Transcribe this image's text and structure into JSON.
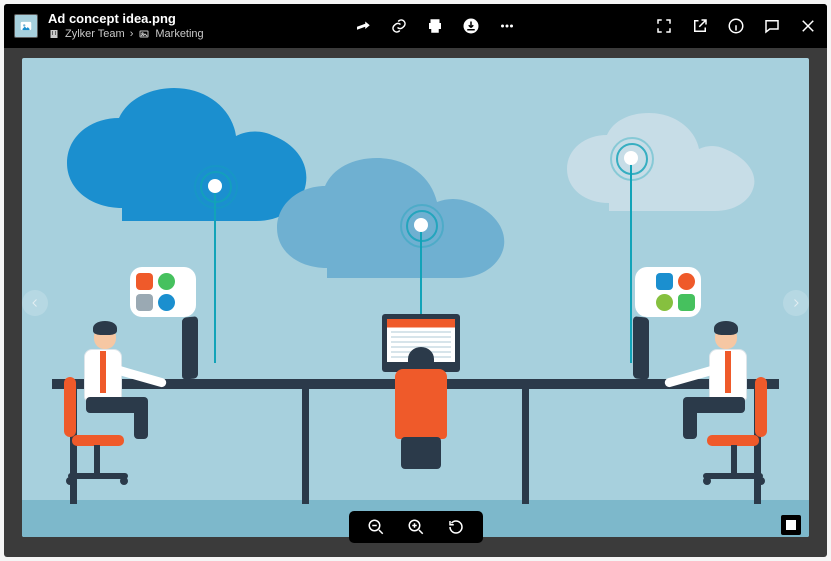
{
  "header": {
    "file_title": "Ad concept idea.png",
    "breadcrumb": {
      "team": "Zylker Team",
      "folder": "Marketing"
    }
  },
  "icons": {
    "share": "share-icon",
    "link": "link-icon",
    "print": "print-icon",
    "download": "download-icon",
    "more": "more-icon",
    "fullscreen": "fullscreen-icon",
    "open_external": "open-external-icon",
    "info": "info-icon",
    "comment": "comment-icon",
    "close": "close-icon",
    "zoom_out": "zoom-out-icon",
    "zoom_in": "zoom-in-icon",
    "reset": "reset-icon",
    "stop": "stop-slideshow-icon",
    "prev": "prev-image-icon",
    "next": "next-image-icon"
  },
  "image_content": {
    "description": "Flat illustration of three people at a long desk, each connected to a cloud above their computer, representing cloud-based teamwork.",
    "palette": {
      "sky": "#a7d0dd",
      "ground": "#7db8cb",
      "cloud_dark": "#1b8fcf",
      "cloud_mid": "#6fb0d1",
      "cloud_light": "#c7dde7",
      "accent": "#12a3b8",
      "orange": "#ef5a2a",
      "navy": "#2b3a4a"
    }
  }
}
